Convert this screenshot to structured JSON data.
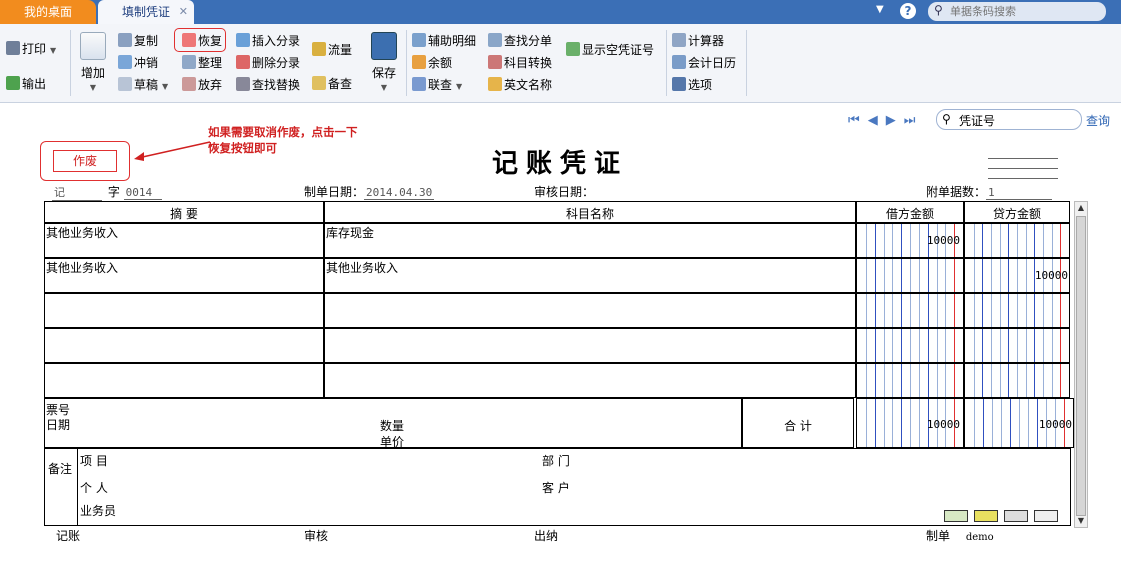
{
  "tabs": [
    {
      "label": "我的桌面",
      "active": false
    },
    {
      "label": "填制凭证",
      "active": true
    }
  ],
  "header_search": {
    "placeholder": "单据条码搜索"
  },
  "toolbar": {
    "print": "打印",
    "export": "输出",
    "add": "增加",
    "copy": "复制",
    "reverse": "冲销",
    "draft": "草稿",
    "restore": "恢复",
    "organize": "整理",
    "discard": "放弃",
    "insert_entry": "插入分录",
    "delete_entry": "删除分录",
    "find_replace": "查找替换",
    "flow": "流量",
    "check": "备查",
    "save": "保存",
    "aux_detail": "辅助明细",
    "balance": "余额",
    "linked_query": "联查",
    "find_entry": "查找分单",
    "account_convert": "科目转换",
    "english_name": "英文名称",
    "show_empty_voucher": "显示空凭证号",
    "calculator": "计算器",
    "accounting_calendar": "会计日历",
    "options": "选项"
  },
  "voucher_search": {
    "value": "凭证号",
    "query_label": "查询"
  },
  "annotation": "如果需要取消作废，点击一下恢复按钮即可",
  "void_stamp": "作废",
  "voucher": {
    "title": "记账凭证",
    "type_label": "记",
    "number_prefix": "字",
    "number": "0014",
    "date_label": "制单日期：",
    "date": "2014.04.30",
    "audit_date_label": "审核日期：",
    "attach_label": "附单据数：",
    "attach_count": "1",
    "headers": {
      "summary": "摘 要",
      "account": "科目名称",
      "debit": "借方金额",
      "credit": "贷方金额"
    },
    "rows": [
      {
        "summary": "其他业务收入",
        "account": "库存现金",
        "debit": "10000",
        "credit": ""
      },
      {
        "summary": "其他业务收入",
        "account": "其他业务收入",
        "debit": "",
        "credit": "10000"
      },
      {
        "summary": "",
        "account": "",
        "debit": "",
        "credit": ""
      },
      {
        "summary": "",
        "account": "",
        "debit": "",
        "credit": ""
      },
      {
        "summary": "",
        "account": "",
        "debit": "",
        "credit": ""
      }
    ],
    "ticket_no_label": "票号",
    "date2_label": "日期",
    "qty_label": "数量",
    "price_label": "单价",
    "total_label": "合 计",
    "total_debit": "10000",
    "total_credit": "10000",
    "notes_label": "备注",
    "project_label": "项  目",
    "dept_label": "部  门",
    "person_label": "个  人",
    "customer_label": "客  户",
    "salesman_label": "业务员",
    "footer": {
      "bookkeeping": "记账",
      "audit": "审核",
      "cashier": "出纳",
      "maker_label": "制单",
      "maker": "demo"
    }
  },
  "colors": {
    "topbar": "#3b6fb6",
    "home_tab": "#f28c1e",
    "annotation": "#d02020"
  }
}
